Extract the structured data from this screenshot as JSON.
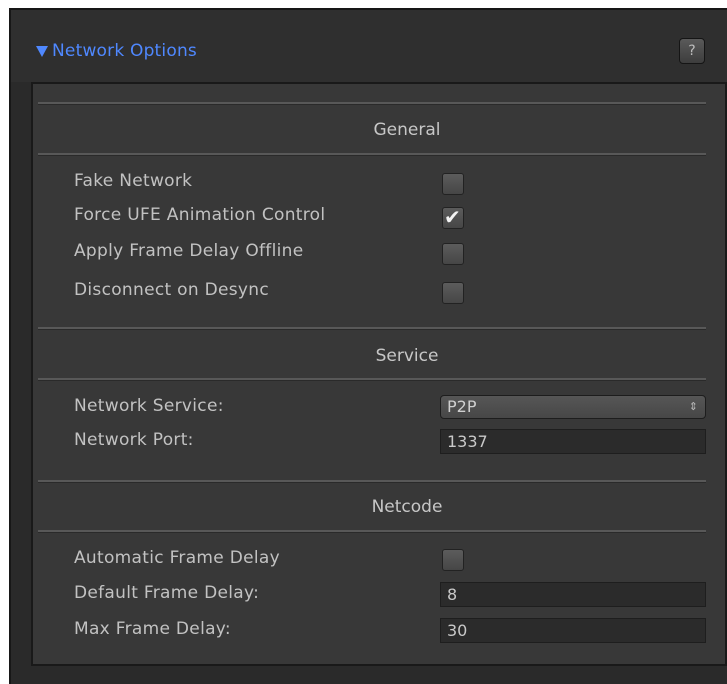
{
  "header": {
    "title": "Network Options",
    "help_label": "?"
  },
  "sections": {
    "general": {
      "title": "General",
      "fake_network": {
        "label": "Fake Network",
        "checked": false
      },
      "force_ufe": {
        "label": "Force UFE Animation Control",
        "checked": true
      },
      "apply_delay_offline": {
        "label": "Apply Frame Delay Offline",
        "checked": false
      },
      "disconnect_desync": {
        "label": "Disconnect on Desync",
        "checked": false
      }
    },
    "service": {
      "title": "Service",
      "network_service": {
        "label": "Network Service:",
        "value": "P2P"
      },
      "network_port": {
        "label": "Network Port:",
        "value": "1337"
      }
    },
    "netcode": {
      "title": "Netcode",
      "auto_delay": {
        "label": "Automatic Frame Delay",
        "checked": false
      },
      "default_delay": {
        "label": "Default Frame Delay:",
        "value": "8"
      },
      "max_delay": {
        "label": "Max Frame Delay:",
        "value": "30"
      }
    }
  },
  "icons": {
    "foldout": "triangle-down-icon",
    "check": "checkmark-icon",
    "dropdown_arrows": "up-down-arrows-icon"
  },
  "colors": {
    "accent": "#4f88ff",
    "panel_bg": "#383838",
    "window_bg": "#2a2a2a"
  }
}
